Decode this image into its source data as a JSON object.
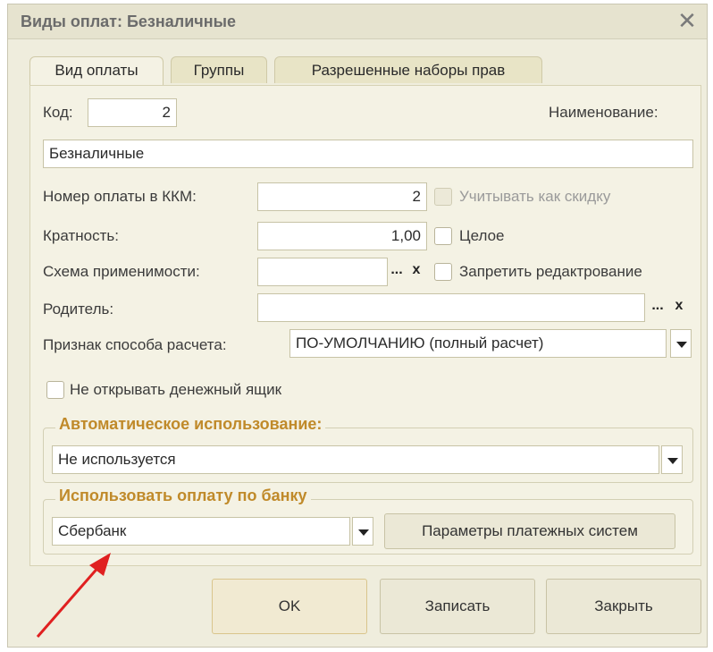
{
  "window": {
    "title": "Виды оплат: Безналичные",
    "close_symbol": "✕"
  },
  "tabs": [
    {
      "label": "Вид оплаты",
      "active": true
    },
    {
      "label": "Группы",
      "active": false
    },
    {
      "label": "Разрешенные наборы прав",
      "active": false
    }
  ],
  "form": {
    "code_label": "Код:",
    "code_value": "2",
    "name_label": "Наименование:",
    "name_value": "Безналичные",
    "kkm_label": "Номер оплаты в ККМ:",
    "kkm_value": "2",
    "discount_label": "Учитывать как скидку",
    "multiplicity_label": "Кратность:",
    "multiplicity_value": "1,00",
    "integer_label": "Целое",
    "scheme_label": "Схема применимости:",
    "scheme_value": "",
    "forbid_edit_label": "Запретить редактрование",
    "parent_label": "Родитель:",
    "parent_value": "",
    "calc_method_label": "Признак способа расчета:",
    "calc_method_value": "ПО-УМОЛЧАНИЮ (полный расчет)",
    "cash_drawer_label": "Не открывать денежный ящик",
    "ellipsis": "...",
    "clear_symbol": "x"
  },
  "auto_use": {
    "title": "Автоматическое использование:",
    "value": "Не используется"
  },
  "bank_payment": {
    "title": "Использовать оплату по банку",
    "value": "Сбербанк",
    "params_button": "Параметры платежных систем"
  },
  "footer": {
    "ok": "OK",
    "save": "Записать",
    "close": "Закрыть"
  },
  "colors": {
    "group_title": "#c08a2a",
    "arrow": "#e02020",
    "window_bg": "#efeddd"
  }
}
